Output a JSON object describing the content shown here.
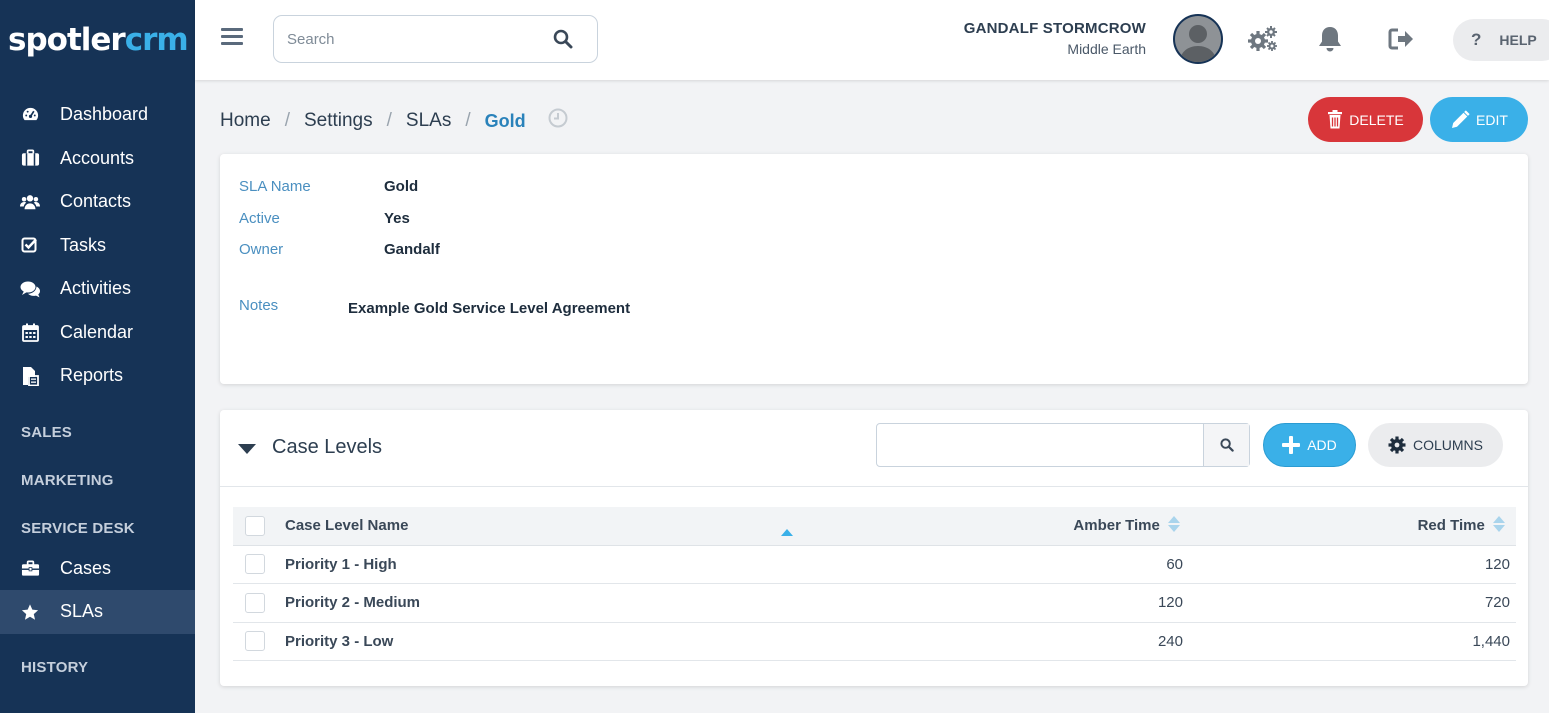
{
  "app": {
    "logo_part1": "spotler",
    "logo_part2": "crm",
    "colors": {
      "sidebar": "#163356",
      "accent": "#3ab0e8",
      "danger": "#d8363a"
    }
  },
  "sidebar": {
    "items": [
      {
        "label": "Dashboard",
        "icon": "dashboard-icon"
      },
      {
        "label": "Accounts",
        "icon": "briefcase-icon"
      },
      {
        "label": "Contacts",
        "icon": "users-icon"
      },
      {
        "label": "Tasks",
        "icon": "checkbox-icon"
      },
      {
        "label": "Activities",
        "icon": "comments-icon"
      },
      {
        "label": "Calendar",
        "icon": "calendar-icon"
      },
      {
        "label": "Reports",
        "icon": "reports-icon"
      }
    ],
    "sections": [
      "SALES",
      "MARKETING",
      "SERVICE DESK",
      "HISTORY"
    ],
    "service_items": [
      {
        "label": "Cases",
        "icon": "toolbox-icon"
      },
      {
        "label": "SLAs",
        "icon": "star-icon",
        "active": true
      }
    ]
  },
  "header": {
    "search_placeholder": "Search",
    "user_name": "GANDALF STORMCROW",
    "user_location": "Middle Earth",
    "help_label": "HELP"
  },
  "breadcrumb": [
    "Home",
    "Settings",
    "SLAs",
    "Gold"
  ],
  "actions": {
    "delete_label": "DELETE",
    "edit_label": "EDIT"
  },
  "details": {
    "sla_name_label": "SLA Name",
    "sla_name": "Gold",
    "active_label": "Active",
    "active": "Yes",
    "owner_label": "Owner",
    "owner": "Gandalf",
    "notes_label": "Notes",
    "notes": "Example Gold Service Level Agreement"
  },
  "case_levels": {
    "title": "Case Levels",
    "add_label": "ADD",
    "columns_label": "COLUMNS",
    "headers": {
      "name": "Case Level Name",
      "amber": "Amber Time",
      "red": "Red Time"
    },
    "rows": [
      {
        "name": "Priority 1 - High",
        "amber": "60",
        "red": "120"
      },
      {
        "name": "Priority 2 - Medium",
        "amber": "120",
        "red": "720"
      },
      {
        "name": "Priority 3 - Low",
        "amber": "240",
        "red": "1,440"
      }
    ]
  }
}
